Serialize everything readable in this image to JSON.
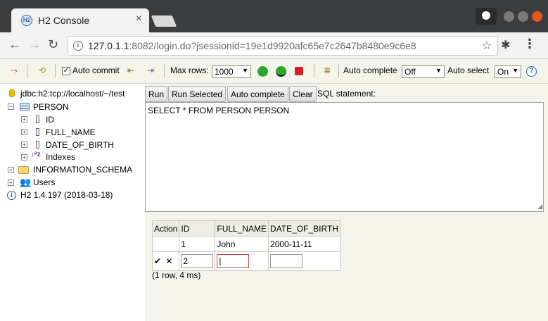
{
  "browser": {
    "tab_title": "H2 Console",
    "url_host": "127.0.1.1",
    "url_rest": ":8082/login.do?jsessionid=19e1d9920afc65e7c2647b8480e9c6e8"
  },
  "toolbar": {
    "auto_commit_label": "Auto commit",
    "max_rows_label": "Max rows:",
    "max_rows_value": "1000",
    "auto_complete_label": "Auto complete",
    "auto_complete_value": "Off",
    "auto_select_label": "Auto select",
    "auto_select_value": "On"
  },
  "tree": {
    "connection": "jdbc:h2:tcp://localhost/~/test",
    "table": "PERSON",
    "columns": [
      "ID",
      "FULL_NAME",
      "DATE_OF_BIRTH"
    ],
    "indexes": "Indexes",
    "schema": "INFORMATION_SCHEMA",
    "users": "Users",
    "version": "H2 1.4.197 (2018-03-18)"
  },
  "sql": {
    "run": "Run",
    "run_selected": "Run Selected",
    "auto_complete": "Auto complete",
    "clear": "Clear",
    "label": "SQL statement:",
    "text": "SELECT * FROM PERSON PERSON"
  },
  "result": {
    "headers": [
      "Action",
      "ID",
      "FULL_NAME",
      "DATE_OF_BIRTH"
    ],
    "row": {
      "id": "1",
      "full_name": "John",
      "dob": "2000-11-11"
    },
    "edit_row": {
      "id": "2",
      "full_name": "",
      "dob": ""
    },
    "status": "(1 row, 4 ms)"
  }
}
